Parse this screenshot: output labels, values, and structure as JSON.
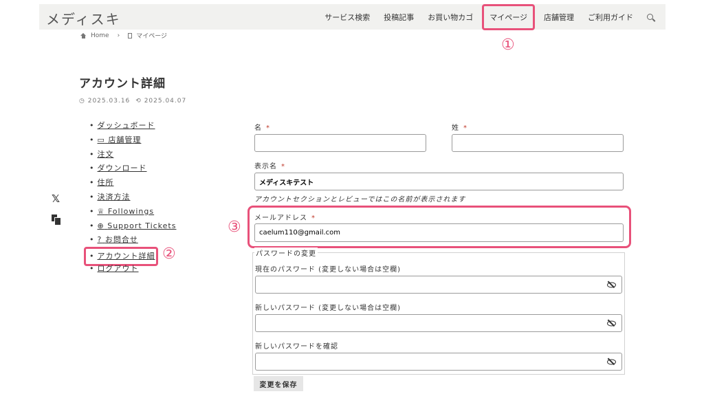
{
  "header": {
    "logo": "メディスキ",
    "nav": [
      "サービス検索",
      "投稿記事",
      "お買い物カゴ",
      "マイページ",
      "店舗管理",
      "ご利用ガイド"
    ]
  },
  "annotations": {
    "a1": "①",
    "a2": "②",
    "a3": "③"
  },
  "breadcrumb": {
    "home": "Home",
    "sep": "›",
    "current": "マイページ"
  },
  "page": {
    "title": "アカウント詳細",
    "published": "2025.03.16",
    "updated": "2025.04.07",
    "published_glyph": "◷",
    "updated_glyph": "⟲"
  },
  "social": {
    "x": "𝕏"
  },
  "menu": {
    "bullet": "•",
    "items": [
      "ダッシュボード",
      "店舗管理",
      "注文",
      "ダウンロード",
      "住所",
      "決済方法",
      "Followings",
      "Support Tickets",
      "お問合せ",
      "アカウント詳細",
      "ログアウト"
    ],
    "icons": {
      "store": "▭",
      "followings": "♕",
      "support": "⊕",
      "contact": "?"
    }
  },
  "form": {
    "first_name_label": "名",
    "first_name_value": "",
    "last_name_label": "姓",
    "last_name_value": "",
    "display_name_label": "表示名",
    "display_name_value": "メディスキテスト",
    "display_name_hint": "アカウントセクションとレビューではこの名前が表示されます",
    "email_label": "メールアドレス",
    "email_value": "caelum110@gmail.com",
    "required_mark": "*",
    "password_legend": "パスワードの変更",
    "current_password_label": "現在のパスワード (変更しない場合は空欄)",
    "new_password_label": "新しいパスワード (変更しない場合は空欄)",
    "confirm_password_label": "新しいパスワードを確認",
    "save_label": "変更を保存"
  },
  "colors": {
    "highlight": "#e8517a",
    "header_bg": "#f1f1ef",
    "required": "#c0392b"
  }
}
